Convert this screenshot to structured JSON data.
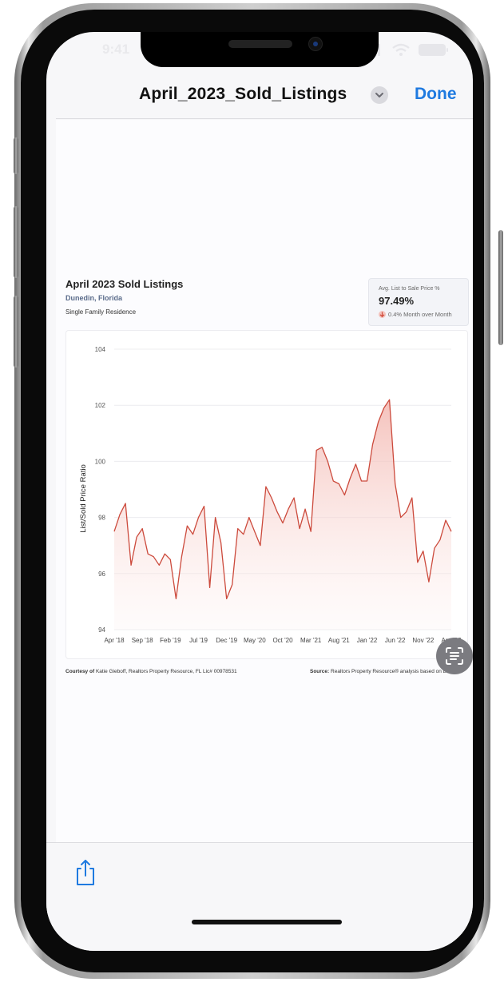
{
  "status_bar": {
    "time": "9:41"
  },
  "nav": {
    "title": "April_2023_Sold_Listings",
    "done_label": "Done"
  },
  "document": {
    "title": "April 2023 Sold Listings",
    "location": "Dunedin, Florida",
    "property_type": "Single Family Residence",
    "stat_card": {
      "label": "Avg. List to Sale Price %",
      "value": "97.49%",
      "change": "0.4% Month over Month",
      "direction": "down"
    },
    "footer": {
      "courtesy_prefix": "Courtesy of",
      "courtesy_text": "Katie Gieboff, Realtors Property Resource, FL Lic# 00978531",
      "source_prefix": "Source:",
      "source_text": "Realtors Property Resource® analysis based on Listings"
    }
  },
  "chart_data": {
    "type": "area",
    "ylabel": "List/Sold Price Ratio",
    "ylim": [
      94,
      104
    ],
    "yticks": [
      94,
      96,
      98,
      100,
      102,
      104
    ],
    "x_ticks": [
      "Apr '18",
      "Sep '18",
      "Feb '19",
      "Jul '19",
      "Dec '19",
      "May '20",
      "Oct '20",
      "Mar '21",
      "Aug '21",
      "Jan '22",
      "Jun '22",
      "Nov '22",
      "Apr '23"
    ],
    "x_start": "Apr 2018",
    "x_end": "Apr 2023",
    "values": [
      97.5,
      98.1,
      98.5,
      96.3,
      97.3,
      97.6,
      96.7,
      96.6,
      96.3,
      96.7,
      96.5,
      95.1,
      96.6,
      97.7,
      97.4,
      98.0,
      98.4,
      95.5,
      98.0,
      97.1,
      95.1,
      95.6,
      97.6,
      97.4,
      98.0,
      97.5,
      97.0,
      99.1,
      98.7,
      98.2,
      97.8,
      98.3,
      98.7,
      97.6,
      98.3,
      97.5,
      100.4,
      100.5,
      100.0,
      99.3,
      99.2,
      98.8,
      99.4,
      99.9,
      99.3,
      99.3,
      100.6,
      101.4,
      101.9,
      102.2,
      99.2,
      98.0,
      98.2,
      98.7,
      96.4,
      96.8,
      95.7,
      96.9,
      97.2,
      97.9,
      97.5
    ],
    "line_color": "#cc4a3c",
    "fill_color": "#f6c6c1",
    "grid": true
  },
  "toolbar": {
    "share_icon": "share-icon"
  },
  "colors": {
    "accent": "#1f7ae0",
    "line": "#cc4a3c"
  }
}
